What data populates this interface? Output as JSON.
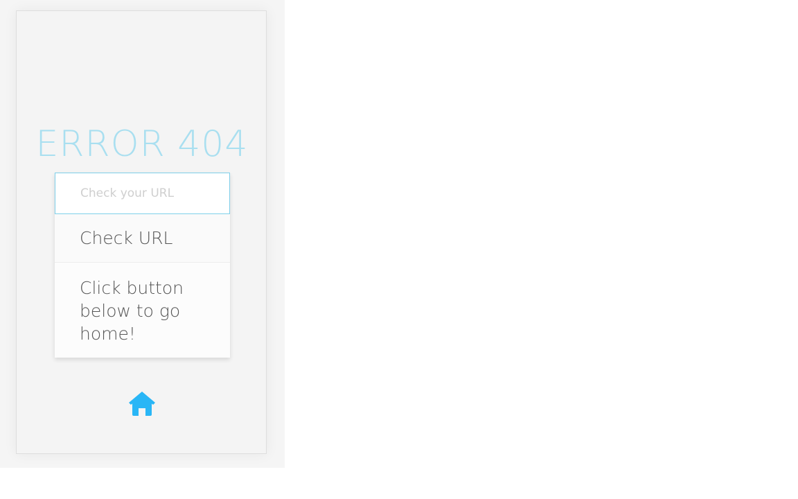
{
  "error": {
    "title": "ERROR 404"
  },
  "url_check": {
    "placeholder": "Check your URL",
    "value": "",
    "button_label": "Check URL"
  },
  "hint": {
    "text": "Click button below to go home!"
  },
  "home": {
    "icon": "home-icon",
    "color": "#29b6f6"
  },
  "colors": {
    "title": "#a9dff0",
    "input_border": "#7fd0ea",
    "text": "#555555"
  }
}
